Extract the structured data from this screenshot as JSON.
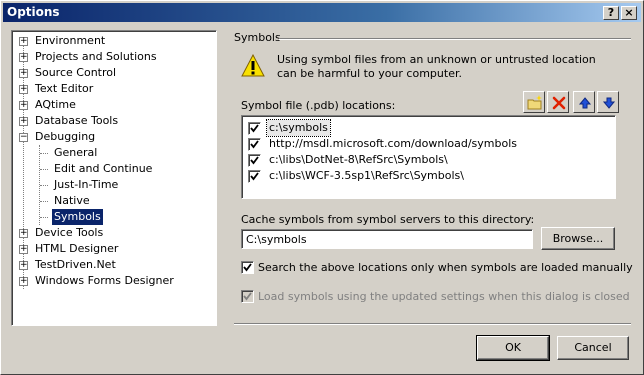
{
  "window": {
    "title": "Options",
    "help_glyph": "?",
    "close_glyph": "×"
  },
  "tree": {
    "items": [
      {
        "label": "Environment",
        "expander": "+"
      },
      {
        "label": "Projects and Solutions",
        "expander": "+"
      },
      {
        "label": "Source Control",
        "expander": "+"
      },
      {
        "label": "Text Editor",
        "expander": "+"
      },
      {
        "label": "AQtime",
        "expander": "+"
      },
      {
        "label": "Database Tools",
        "expander": "+"
      },
      {
        "label": "Debugging",
        "expander": "−"
      },
      {
        "label": "General"
      },
      {
        "label": "Edit and Continue"
      },
      {
        "label": "Just-In-Time"
      },
      {
        "label": "Native"
      },
      {
        "label": "Symbols",
        "selected": true
      },
      {
        "label": "Device Tools",
        "expander": "+"
      },
      {
        "label": "HTML Designer",
        "expander": "+"
      },
      {
        "label": "TestDriven.Net",
        "expander": "+"
      },
      {
        "label": "Windows Forms Designer",
        "expander": "+"
      }
    ]
  },
  "symbols": {
    "section_title": "Symbols",
    "warning_text": "Using symbol files from an unknown or untrusted location can be harmful to your computer.",
    "locations_label": "Symbol file (.pdb) locations:",
    "toolbar": {
      "icons": [
        "new-folder-icon",
        "delete-icon",
        "move-up-icon",
        "move-down-icon"
      ]
    },
    "locations": [
      {
        "path": "c:\\symbols",
        "checked": true
      },
      {
        "path": "http://msdl.microsoft.com/download/symbols",
        "checked": true
      },
      {
        "path": "c:\\libs\\DotNet-8\\RefSrc\\Symbols\\",
        "checked": true
      },
      {
        "path": "c:\\libs\\WCF-3.5sp1\\RefSrc\\Symbols\\",
        "checked": true
      }
    ],
    "cache_label": "Cache symbols from symbol servers to this directory:",
    "cache_value": "C:\\symbols",
    "browse_label": "Browse...",
    "option_manual": {
      "label": "Search the above locations only when symbols are loaded manually",
      "checked": true,
      "enabled": true
    },
    "option_updated": {
      "label": "Load symbols using the updated settings when this dialog is closed",
      "checked": true,
      "enabled": false
    }
  },
  "buttons": {
    "ok": "OK",
    "cancel": "Cancel"
  },
  "colors": {
    "titlebar_start": "#0a246a",
    "titlebar_end": "#a6caf0",
    "face": "#d4d0c8",
    "selection": "#0a246a"
  }
}
